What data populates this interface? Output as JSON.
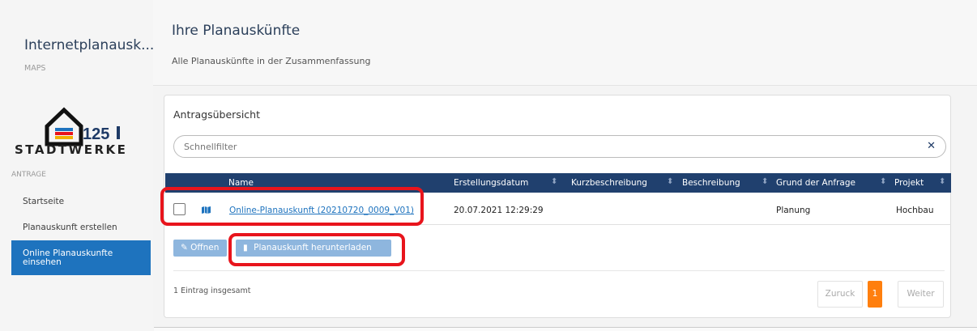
{
  "sidebar": {
    "app_title": "Internetplanausk...",
    "app_subtitle": "MAPS",
    "logo_number": "125",
    "logo_text": "STADTWERKE",
    "section_label": "ANTRAGE",
    "items": [
      {
        "label": "Startseite"
      },
      {
        "label": "Planauskunft erstellen"
      },
      {
        "label": "Online Planauskunfte einsehen"
      }
    ]
  },
  "header": {
    "title": "Ihre Planauskünfte",
    "subtitle": "Alle Planauskünfte in der Zusammenfassung"
  },
  "panel": {
    "title": "Antragsübersicht",
    "filter_placeholder": "Schnellfilter",
    "columns": [
      "Name",
      "Erstellungsdatum",
      "Kurzbeschreibung",
      "Beschreibung",
      "Grund der Anfrage",
      "Projekt"
    ],
    "rows": [
      {
        "name": "Online-Planauskunft (20210720_0009_V01)",
        "date": "20.07.2021 12:29:29",
        "short_desc": "",
        "desc": "",
        "reason": "Planung",
        "project": "Hochbau"
      }
    ],
    "open_label": "Offnen",
    "download_label": "Planauskunft herunterladen",
    "count_text": "1 Eintrag insgesamt",
    "prev_label": "Zuruck",
    "current_page": "1",
    "next_label": "Weiter"
  },
  "colors": {
    "header_bg": "#20406e",
    "active_nav": "#1e73be",
    "button": "#8eb6de",
    "page_active": "#ff7f0e",
    "highlight": "#e8141c"
  }
}
